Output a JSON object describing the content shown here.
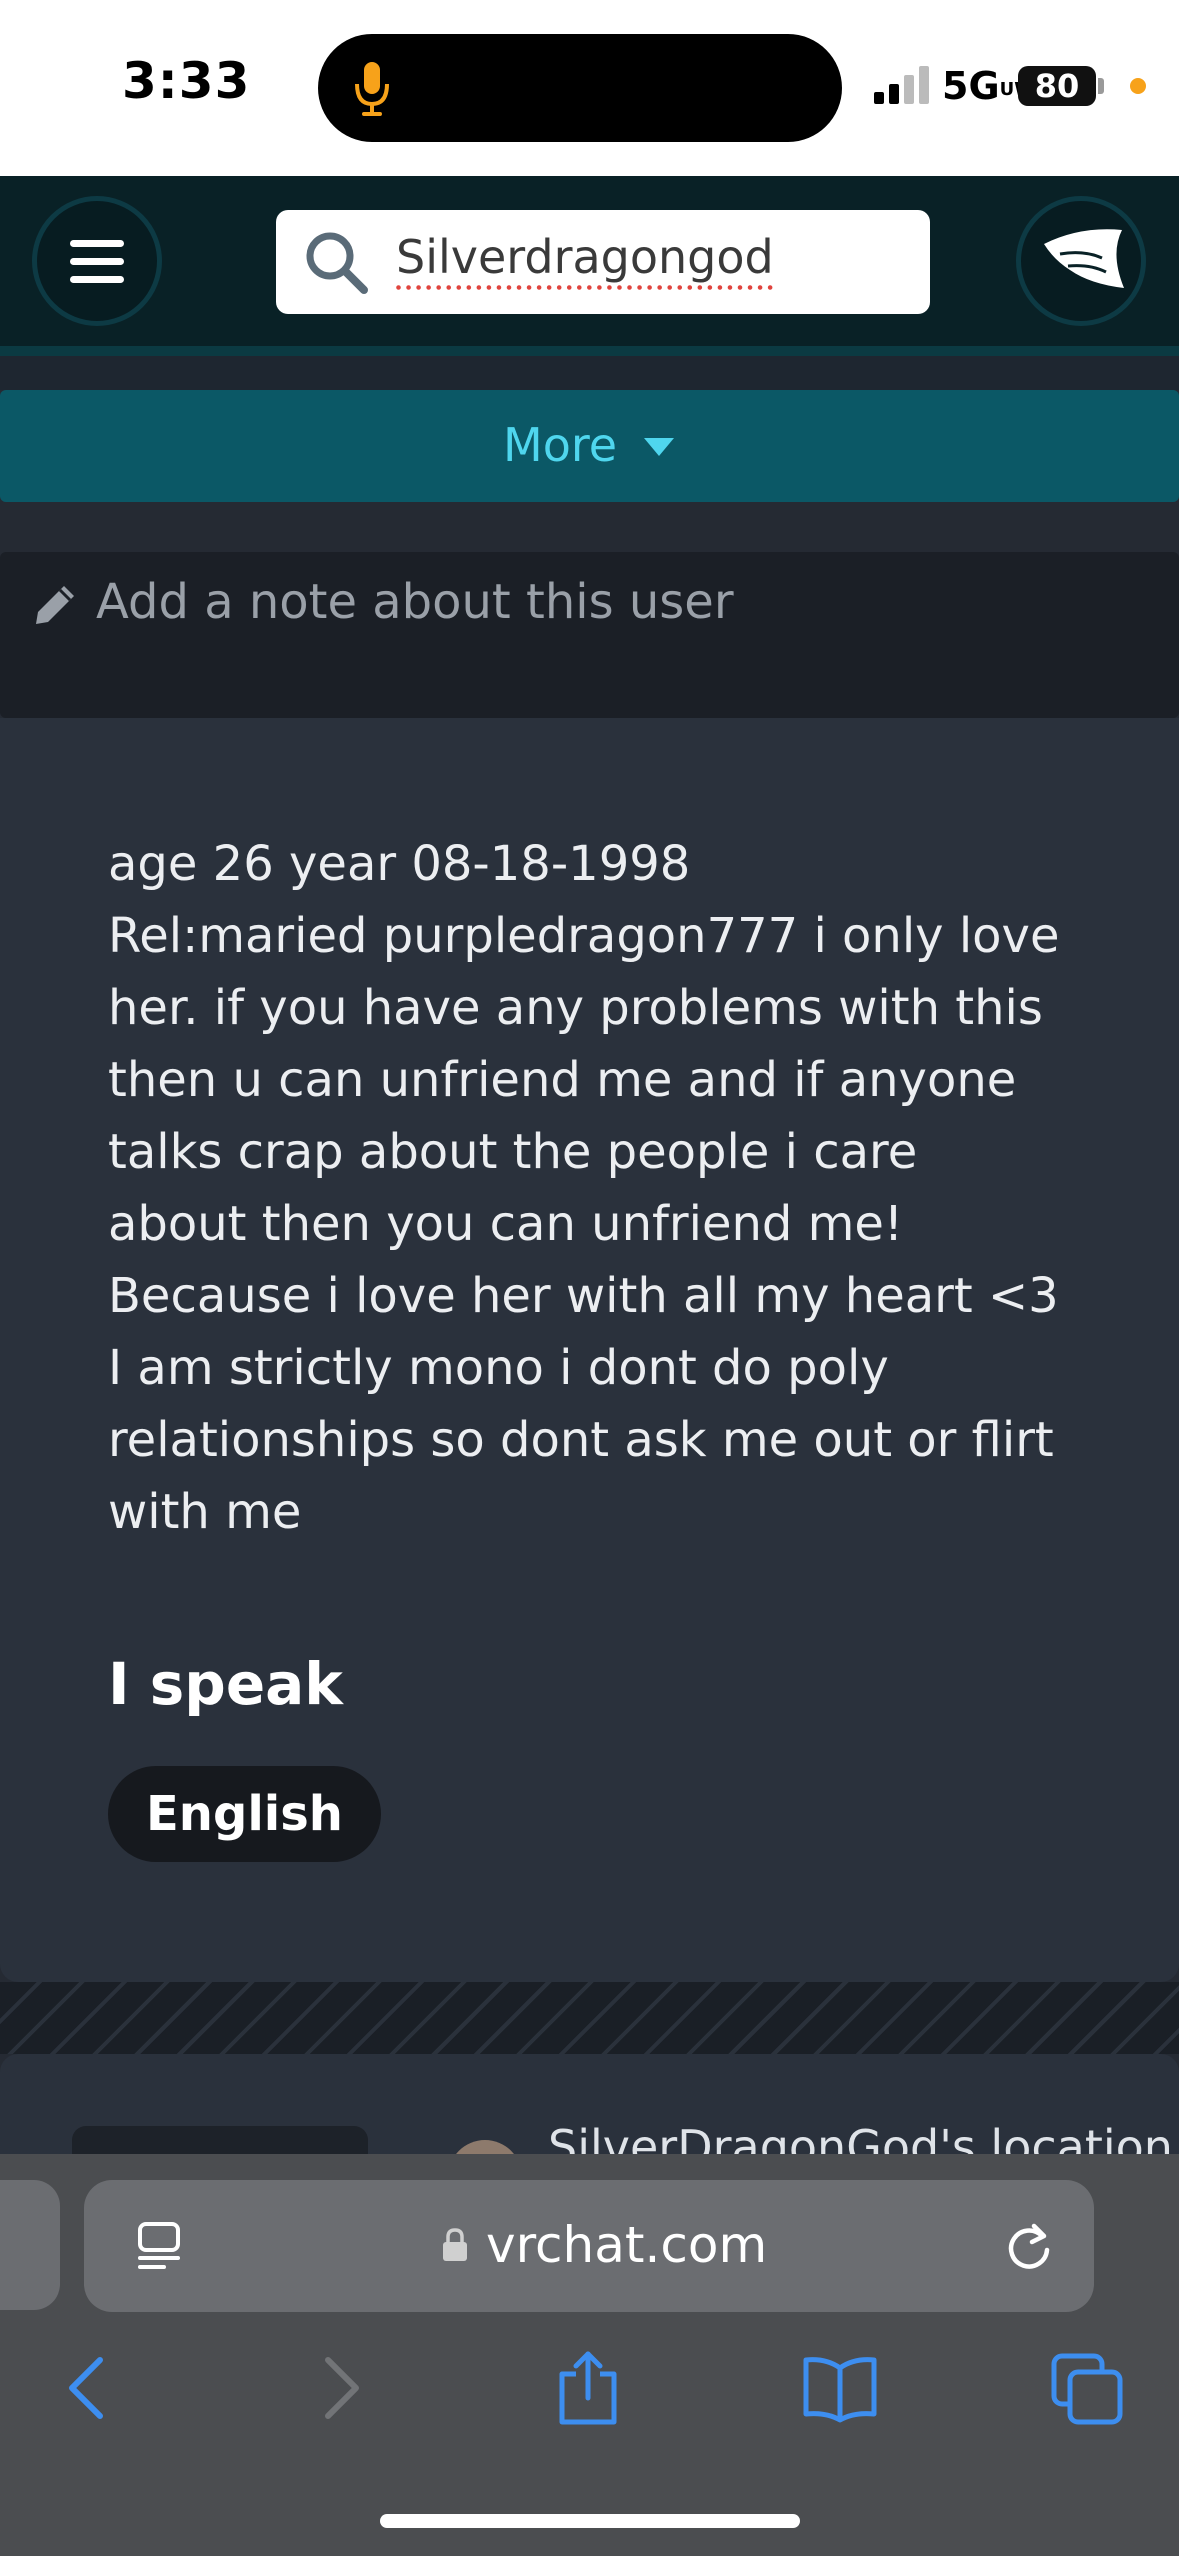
{
  "status": {
    "time": "3:33",
    "network": "5G",
    "network_suffix": "UW",
    "battery": "80"
  },
  "nav": {
    "search_value": "Silverdragongod"
  },
  "more": {
    "label": "More"
  },
  "note": {
    "placeholder": "Add a note about this user"
  },
  "bio": {
    "text": "age 26 year 08-18-1998\nRel:maried purpledragon777 i only love her. if you have any problems with this then u can unfriend me and if anyone talks crap about the people i care about then you can unfriend me! Because i love her with all my heart <3\nI am strictly mono i dont do poly relationships so dont ask me out or flirt with me"
  },
  "languages": {
    "heading": "I speak",
    "items": [
      "English"
    ]
  },
  "next_card": {
    "text": "SilverDragonGod's location"
  },
  "browser": {
    "url": "vrchat.com"
  },
  "colors": {
    "accent": "#4fd6ee",
    "nav_bg": "#092126",
    "browser_blue": "#3d8ef0"
  }
}
